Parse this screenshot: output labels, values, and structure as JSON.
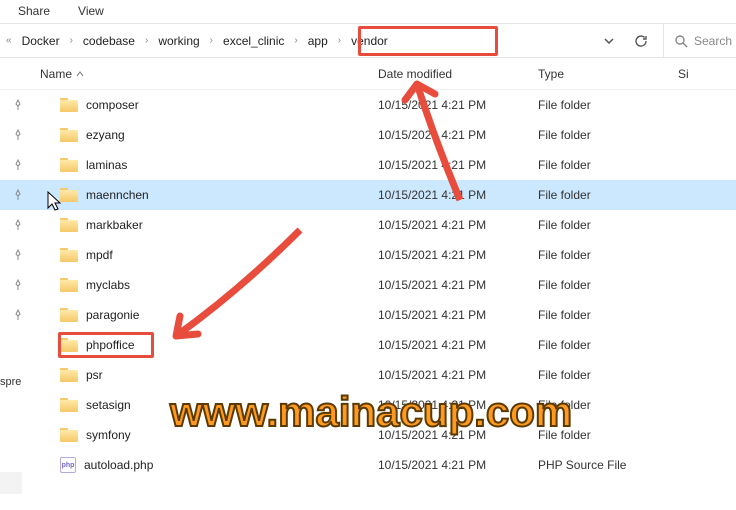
{
  "tabs": {
    "share": "Share",
    "view": "View"
  },
  "breadcrumb": [
    "Docker",
    "codebase",
    "working",
    "excel_clinic",
    "app",
    "vendor"
  ],
  "search": {
    "placeholder": "Search"
  },
  "columns": {
    "name": "Name",
    "date": "Date modified",
    "type": "Type",
    "size": "Si"
  },
  "rows": [
    {
      "icon": "folder",
      "name": "composer",
      "date": "10/15/2021 4:21 PM",
      "type": "File folder",
      "pin": true
    },
    {
      "icon": "folder",
      "name": "ezyang",
      "date": "10/15/2021 4:21 PM",
      "type": "File folder",
      "pin": true
    },
    {
      "icon": "folder",
      "name": "laminas",
      "date": "10/15/2021 4:21 PM",
      "type": "File folder",
      "pin": true
    },
    {
      "icon": "folder",
      "name": "maennchen",
      "date": "10/15/2021 4:21 PM",
      "type": "File folder",
      "pin": true,
      "selected": true
    },
    {
      "icon": "folder",
      "name": "markbaker",
      "date": "10/15/2021 4:21 PM",
      "type": "File folder",
      "pin": true
    },
    {
      "icon": "folder",
      "name": "mpdf",
      "date": "10/15/2021 4:21 PM",
      "type": "File folder",
      "pin": true
    },
    {
      "icon": "folder",
      "name": "myclabs",
      "date": "10/15/2021 4:21 PM",
      "type": "File folder",
      "pin": true
    },
    {
      "icon": "folder",
      "name": "paragonie",
      "date": "10/15/2021 4:21 PM",
      "type": "File folder",
      "pin": true
    },
    {
      "icon": "folder",
      "name": "phpoffice",
      "date": "10/15/2021 4:21 PM",
      "type": "File folder",
      "pin": false
    },
    {
      "icon": "folder",
      "name": "psr",
      "date": "10/15/2021 4:21 PM",
      "type": "File folder",
      "pin": false
    },
    {
      "icon": "folder",
      "name": "setasign",
      "date": "10/15/2021 4:21 PM",
      "type": "File folder",
      "pin": false
    },
    {
      "icon": "folder",
      "name": "symfony",
      "date": "10/15/2021 4:21 PM",
      "type": "File folder",
      "pin": false
    },
    {
      "icon": "php",
      "name": "autoload.php",
      "date": "10/15/2021 4:21 PM",
      "type": "PHP Source File",
      "pin": false
    }
  ],
  "sidebar_label": "spre",
  "watermark": "www.mainacup.com"
}
